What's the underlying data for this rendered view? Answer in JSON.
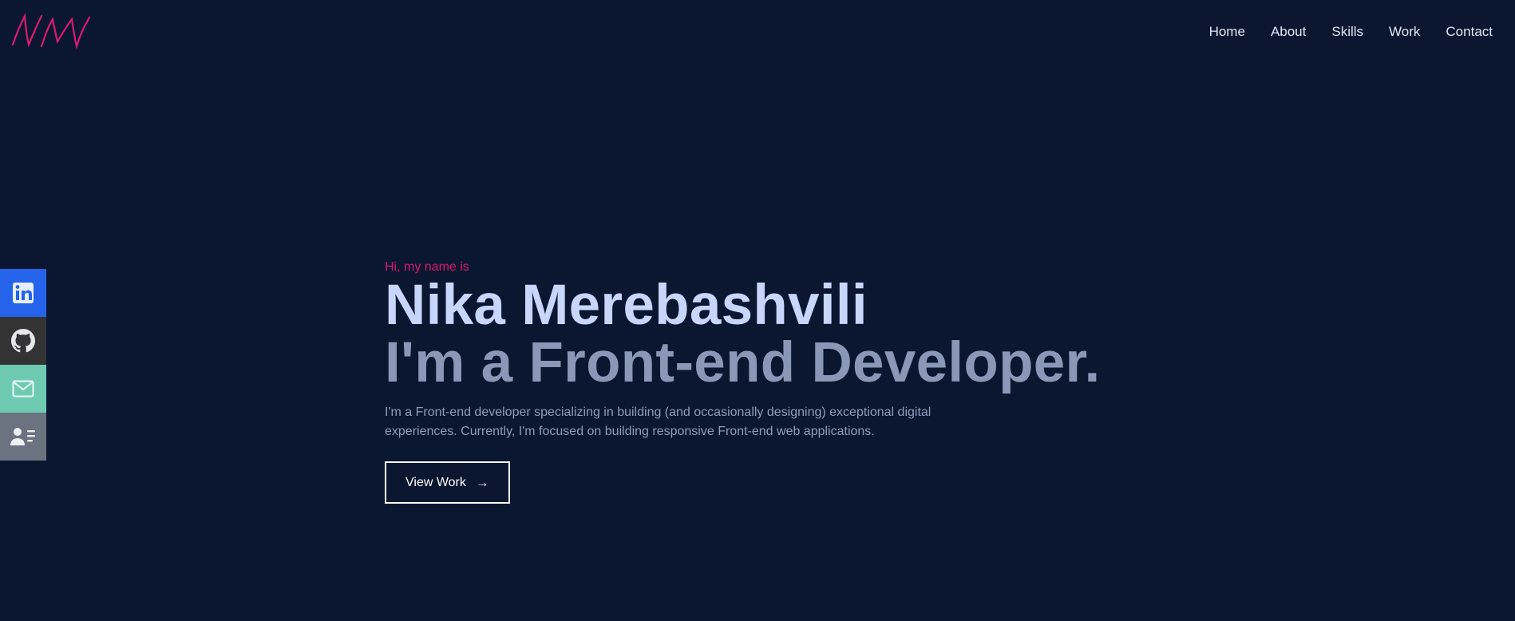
{
  "logo": {
    "text": "NM",
    "color": "#d81b6f"
  },
  "nav": {
    "items": [
      {
        "label": "Home"
      },
      {
        "label": "About"
      },
      {
        "label": "Skills"
      },
      {
        "label": "Work"
      },
      {
        "label": "Contact"
      }
    ]
  },
  "social": [
    {
      "icon": "linkedin-icon",
      "color": "#2563eb"
    },
    {
      "icon": "github-icon",
      "color": "#333333"
    },
    {
      "icon": "mail-icon",
      "color": "#6ecbb2"
    },
    {
      "icon": "resume-icon",
      "color": "#6b7280"
    }
  ],
  "hero": {
    "greeting": "Hi, my name is",
    "name": "Nika Merebashvili",
    "role": "I'm a Front-end Developer.",
    "description": "I'm a Front-end developer specializing in building (and occasionally designing) exceptional digital experiences. Currently, I'm focused on building responsive Front-end web applications.",
    "cta_label": "View Work",
    "cta_arrow": "→"
  },
  "colors": {
    "background": "#0b1730",
    "accent": "#d81b6f",
    "heading": "#c9d6fb",
    "subheading": "#8b97b6"
  }
}
